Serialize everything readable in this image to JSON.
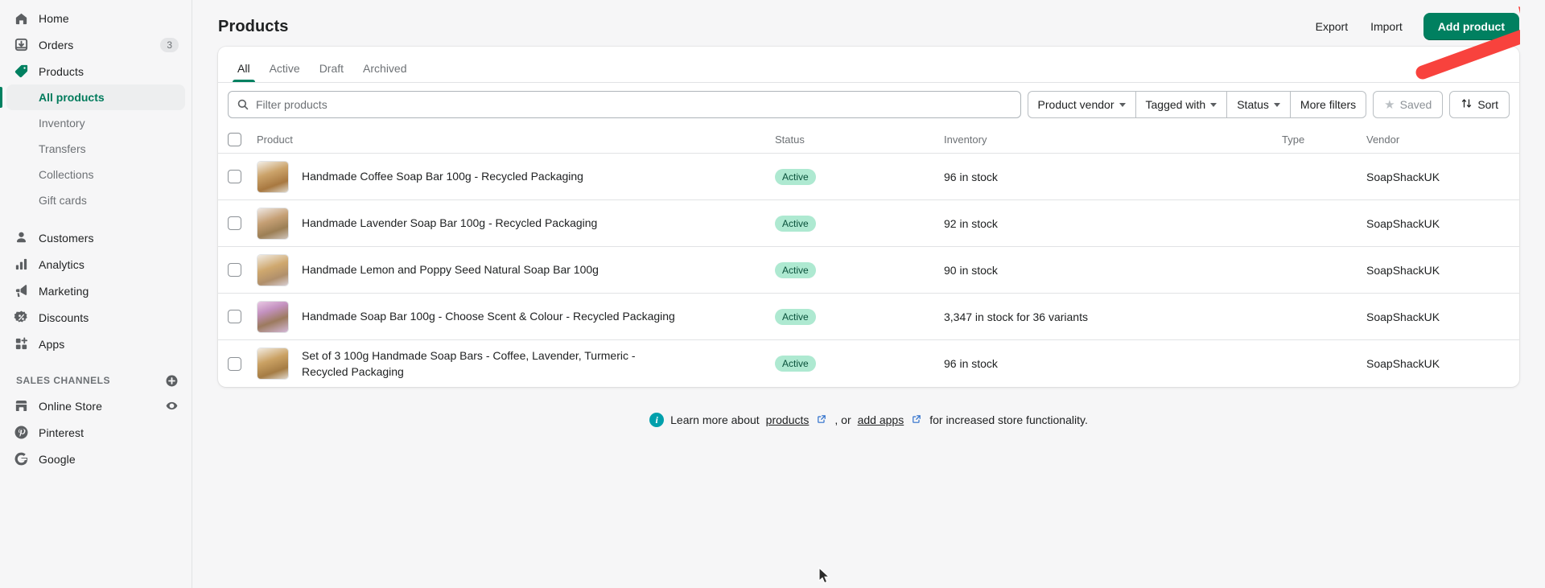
{
  "sidebar": {
    "primary": [
      {
        "label": "Home",
        "icon": "home-icon",
        "badge": ""
      },
      {
        "label": "Orders",
        "icon": "orders-icon",
        "badge": "3"
      },
      {
        "label": "Products",
        "icon": "products-tag-icon",
        "badge": ""
      }
    ],
    "product_subitems": [
      {
        "label": "All products",
        "active": true
      },
      {
        "label": "Inventory",
        "active": false
      },
      {
        "label": "Transfers",
        "active": false
      },
      {
        "label": "Collections",
        "active": false
      },
      {
        "label": "Gift cards",
        "active": false
      }
    ],
    "secondary": [
      {
        "label": "Customers",
        "icon": "customers-icon"
      },
      {
        "label": "Analytics",
        "icon": "analytics-icon"
      },
      {
        "label": "Marketing",
        "icon": "marketing-megaphone-icon"
      },
      {
        "label": "Discounts",
        "icon": "discounts-icon"
      },
      {
        "label": "Apps",
        "icon": "apps-icon"
      }
    ],
    "channels_heading": "SALES CHANNELS",
    "channels": [
      {
        "label": "Online Store",
        "icon": "storefront-icon",
        "has_eye": true
      },
      {
        "label": "Pinterest",
        "icon": "pinterest-icon",
        "has_eye": false
      },
      {
        "label": "Google",
        "icon": "google-icon",
        "has_eye": false
      }
    ]
  },
  "header": {
    "title": "Products",
    "export_label": "Export",
    "import_label": "Import",
    "add_product_label": "Add product"
  },
  "tabs": [
    {
      "label": "All",
      "active": true
    },
    {
      "label": "Active",
      "active": false
    },
    {
      "label": "Draft",
      "active": false
    },
    {
      "label": "Archived",
      "active": false
    }
  ],
  "filters": {
    "search_placeholder": "Filter products",
    "search_value": "",
    "product_vendor": "Product vendor",
    "tagged_with": "Tagged with",
    "status": "Status",
    "more_filters": "More filters",
    "saved": "Saved",
    "sort": "Sort"
  },
  "table": {
    "columns": [
      "Product",
      "Status",
      "Inventory",
      "Type",
      "Vendor"
    ],
    "rows": [
      {
        "name": "Handmade Coffee Soap Bar 100g - Recycled Packaging",
        "status": "Active",
        "inventory": "96 in stock",
        "type": "",
        "vendor": "SoapShackUK",
        "thumb": "#c49a63"
      },
      {
        "name": "Handmade Lavender Soap Bar 100g - Recycled Packaging",
        "status": "Active",
        "inventory": "92 in stock",
        "type": "",
        "vendor": "SoapShackUK",
        "thumb": "#bf9a6a"
      },
      {
        "name": "Handmade Lemon and Poppy Seed Natural Soap Bar 100g",
        "status": "Active",
        "inventory": "90 in stock",
        "type": "",
        "vendor": "SoapShackUK",
        "thumb": "#c8a06a"
      },
      {
        "name": "Handmade Soap Bar 100g - Choose Scent & Colour - Recycled Packaging",
        "status": "Active",
        "inventory": "3,347 in stock for 36 variants",
        "type": "",
        "vendor": "SoapShackUK",
        "thumb": "#c79ac4"
      },
      {
        "name": "Set of 3 100g Handmade Soap Bars - Coffee, Lavender, Turmeric - Recycled Packaging",
        "status": "Active",
        "inventory": "96 in stock",
        "type": "",
        "vendor": "SoapShackUK",
        "thumb": "#c79a5e"
      }
    ]
  },
  "footer": {
    "prefix": "Learn more about",
    "link1": "products",
    "middle": ", or",
    "link2": "add apps",
    "suffix": "for increased store functionality."
  },
  "colors": {
    "brand_green": "#008060",
    "badge_bg": "#aee9d1",
    "badge_text": "#08503a",
    "annotation_red": "#f8423d",
    "info_teal": "#00a0ac"
  }
}
